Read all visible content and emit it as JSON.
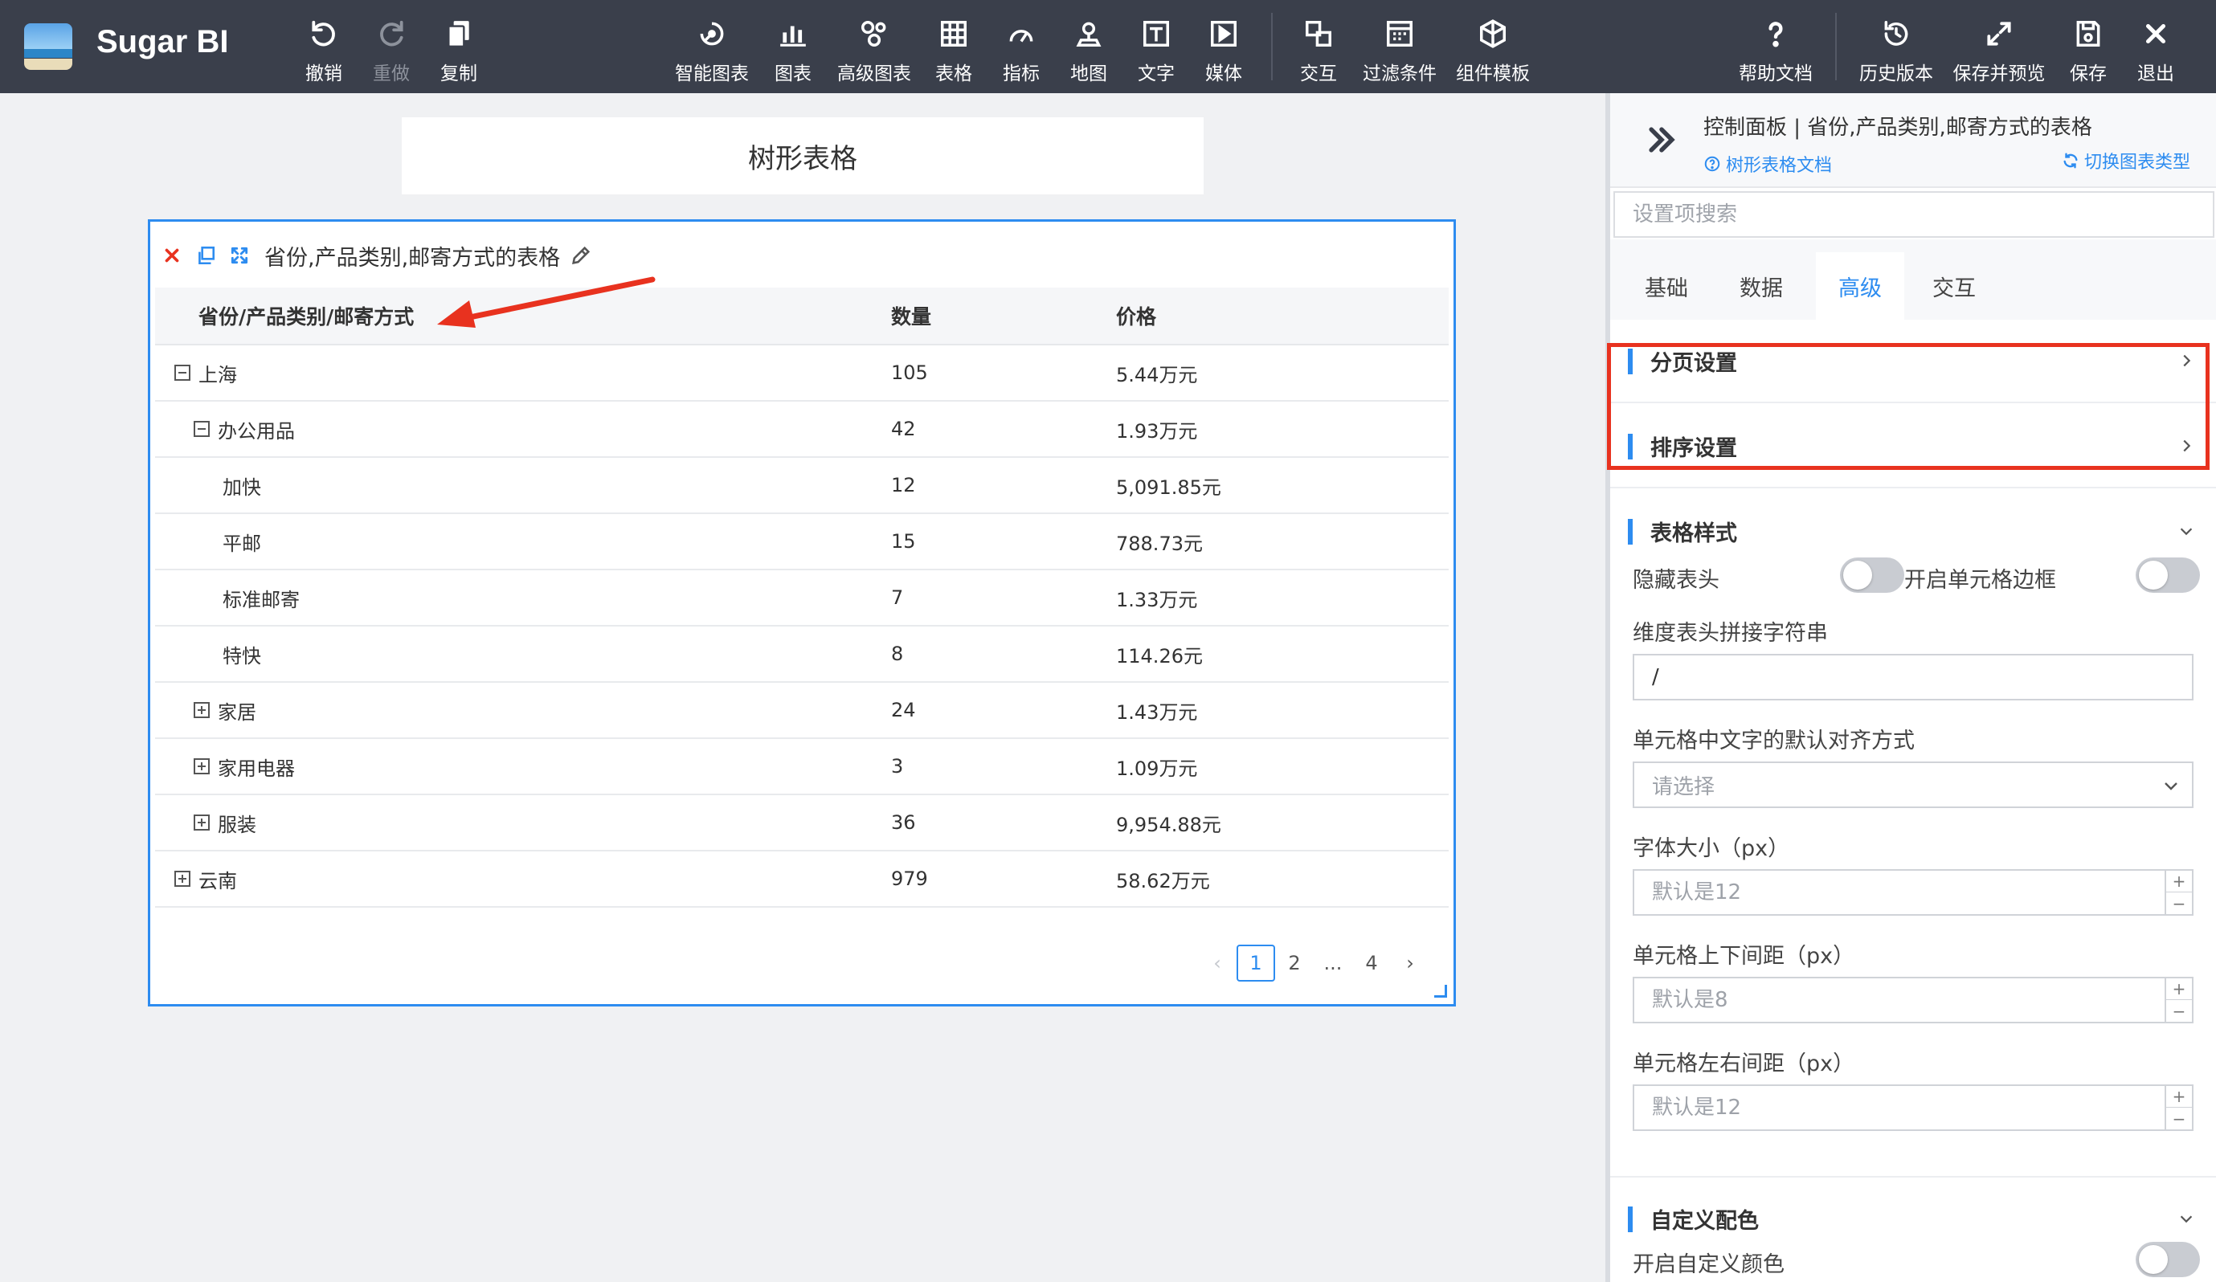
{
  "app": {
    "name": "Sugar BI"
  },
  "toolbar": {
    "left": [
      {
        "id": "undo",
        "label": "撤销",
        "icon": "undo-icon"
      },
      {
        "id": "redo",
        "label": "重做",
        "icon": "redo-icon",
        "disabled": true
      },
      {
        "id": "copy",
        "label": "复制",
        "icon": "copy-icon"
      }
    ],
    "center": [
      {
        "id": "smart-chart",
        "label": "智能图表",
        "icon": "smart-chart-icon"
      },
      {
        "id": "chart",
        "label": "图表",
        "icon": "bar-chart-icon"
      },
      {
        "id": "advanced-chart",
        "label": "高级图表",
        "icon": "advanced-chart-icon"
      },
      {
        "id": "table",
        "label": "表格",
        "icon": "table-icon"
      },
      {
        "id": "metric",
        "label": "指标",
        "icon": "gauge-icon"
      },
      {
        "id": "map",
        "label": "地图",
        "icon": "map-pin-icon"
      },
      {
        "id": "text",
        "label": "文字",
        "icon": "text-icon"
      },
      {
        "id": "media",
        "label": "媒体",
        "icon": "media-icon"
      },
      {
        "id": "interaction",
        "label": "交互",
        "icon": "interaction-icon"
      },
      {
        "id": "filter",
        "label": "过滤条件",
        "icon": "filter-icon"
      },
      {
        "id": "component-template",
        "label": "组件模板",
        "icon": "template-icon"
      }
    ],
    "right": [
      {
        "id": "help",
        "label": "帮助文档",
        "icon": "help-icon"
      },
      {
        "id": "history",
        "label": "历史版本",
        "icon": "history-icon"
      },
      {
        "id": "save-preview",
        "label": "保存并预览",
        "icon": "expand-icon"
      },
      {
        "id": "save",
        "label": "保存",
        "icon": "save-icon"
      },
      {
        "id": "exit",
        "label": "退出",
        "icon": "close-icon"
      }
    ]
  },
  "canvas": {
    "title": "树形表格",
    "widget": {
      "title": "省份,产品类别,邮寄方式的表格",
      "columns": [
        "省份/产品类别/邮寄方式",
        "数量",
        "价格"
      ],
      "rows": [
        {
          "level": 0,
          "toggle": "minus",
          "name": "上海",
          "qty": "105",
          "price": "5.44万元"
        },
        {
          "level": 1,
          "toggle": "minus",
          "name": "办公用品",
          "qty": "42",
          "price": "1.93万元"
        },
        {
          "level": 2,
          "toggle": "",
          "name": "加快",
          "qty": "12",
          "price": "5,091.85元"
        },
        {
          "level": 2,
          "toggle": "",
          "name": "平邮",
          "qty": "15",
          "price": "788.73元"
        },
        {
          "level": 2,
          "toggle": "",
          "name": "标准邮寄",
          "qty": "7",
          "price": "1.33万元"
        },
        {
          "level": 2,
          "toggle": "",
          "name": "特快",
          "qty": "8",
          "price": "114.26元"
        },
        {
          "level": 1,
          "toggle": "plus",
          "name": "家居",
          "qty": "24",
          "price": "1.43万元"
        },
        {
          "level": 1,
          "toggle": "plus",
          "name": "家用电器",
          "qty": "3",
          "price": "1.09万元"
        },
        {
          "level": 1,
          "toggle": "plus",
          "name": "服装",
          "qty": "36",
          "price": "9,954.88元"
        },
        {
          "level": 0,
          "toggle": "plus",
          "name": "云南",
          "qty": "979",
          "price": "58.62万元"
        }
      ],
      "pagination": {
        "pages": [
          "1",
          "2",
          "...",
          "4"
        ],
        "current": "1"
      }
    }
  },
  "panel": {
    "title": "控制面板 | 省份,产品类别,邮寄方式的表格",
    "doc_link": "树形表格文档",
    "switch_link": "切换图表类型",
    "search_placeholder": "设置项搜索",
    "tabs": [
      "基础",
      "数据",
      "高级",
      "交互"
    ],
    "active_tab": "高级",
    "sections": {
      "pagination": "分页设置",
      "sort": "排序设置",
      "table_style": "表格样式",
      "custom_color": "自定义配色"
    },
    "settings": {
      "hide_header": "隐藏表头",
      "cell_border": "开启单元格边框",
      "dim_header_join_label": "维度表头拼接字符串",
      "dim_header_join_value": "/",
      "text_align_label": "单元格中文字的默认对齐方式",
      "text_align_placeholder": "请选择",
      "font_size_label": "字体大小（px）",
      "font_size_placeholder": "默认是12",
      "cell_vpad_label": "单元格上下间距（px）",
      "cell_vpad_placeholder": "默认是8",
      "cell_hpad_label": "单元格左右间距（px）",
      "cell_hpad_placeholder": "默认是12",
      "custom_color_toggle": "开启自定义颜色"
    }
  },
  "colors": {
    "accent": "#2d8cf0",
    "highlight": "#e8321f",
    "topbar": "#3a3f4b"
  }
}
